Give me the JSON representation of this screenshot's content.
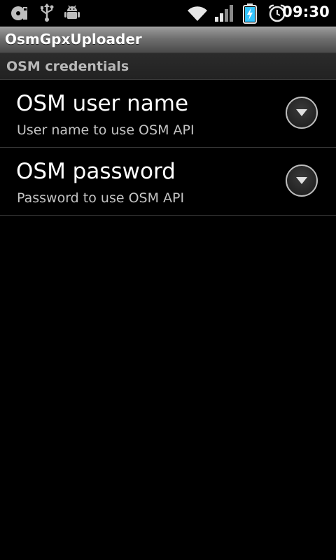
{
  "status_bar": {
    "time": "09:30",
    "icons": [
      "sd-card-icon",
      "usb-icon",
      "android-debug-icon",
      "wifi-icon",
      "signal-icon",
      "battery-charging-icon",
      "alarm-icon"
    ]
  },
  "app": {
    "title": "OsmGpxUploader"
  },
  "category": {
    "label": "OSM credentials"
  },
  "preferences": [
    {
      "title": "OSM user name",
      "summary": "User name to use OSM API",
      "icon": "dropdown-arrow-icon"
    },
    {
      "title": "OSM password",
      "summary": "Password to use OSM API",
      "icon": "dropdown-arrow-icon"
    }
  ],
  "colors": {
    "background": "#000000",
    "battery_accent": "#33c4ff",
    "summary_text": "#c4c4c4"
  }
}
